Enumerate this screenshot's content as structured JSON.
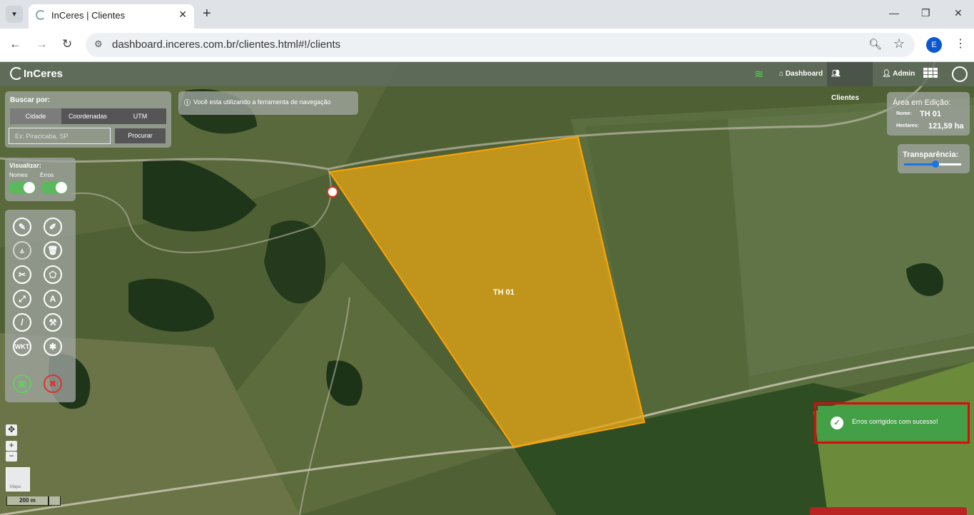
{
  "browser": {
    "tab_title": "InCeres | Clientes",
    "url": "dashboard.inceres.com.br/clientes.html#!/clients",
    "profile_initial": "E"
  },
  "app": {
    "logo": "InCeres",
    "nav": {
      "dashboard": "Dashboard",
      "clientes": "Clientes",
      "admin": "Admin"
    }
  },
  "search": {
    "title": "Buscar por:",
    "tabs": [
      "Cidade",
      "Coordenadas",
      "UTM"
    ],
    "placeholder": "Ex: Piracicaba, SP",
    "button": "Procurar"
  },
  "nav_hint": "Você esta utilizando a ferramenta de navegação",
  "visualizar": {
    "title": "Visualizar:",
    "nomes_label": "Nomes",
    "erros_label": "Erros",
    "nomes_on": true,
    "erros_on": true
  },
  "tools": {
    "wkt_label": "WKT",
    "text_label": "A"
  },
  "map": {
    "polygon_label": "TH 01",
    "basemap_label": "Mapa",
    "scale_label": "200 m",
    "colors": {
      "polygon_fill": "#e2a414",
      "polygon_stroke": "#ffa500",
      "accent": "#43a047"
    }
  },
  "edit_area": {
    "title": "Área em Edição:",
    "nome_label": "Nome:",
    "nome_value": "TH 01",
    "hectares_label": "Hectares:",
    "hectares_value": "121,59 ha"
  },
  "transparency": {
    "label": "Transparência:",
    "value_fraction": 0.55
  },
  "toast": {
    "message": "Erros corrigidos com sucesso!"
  }
}
